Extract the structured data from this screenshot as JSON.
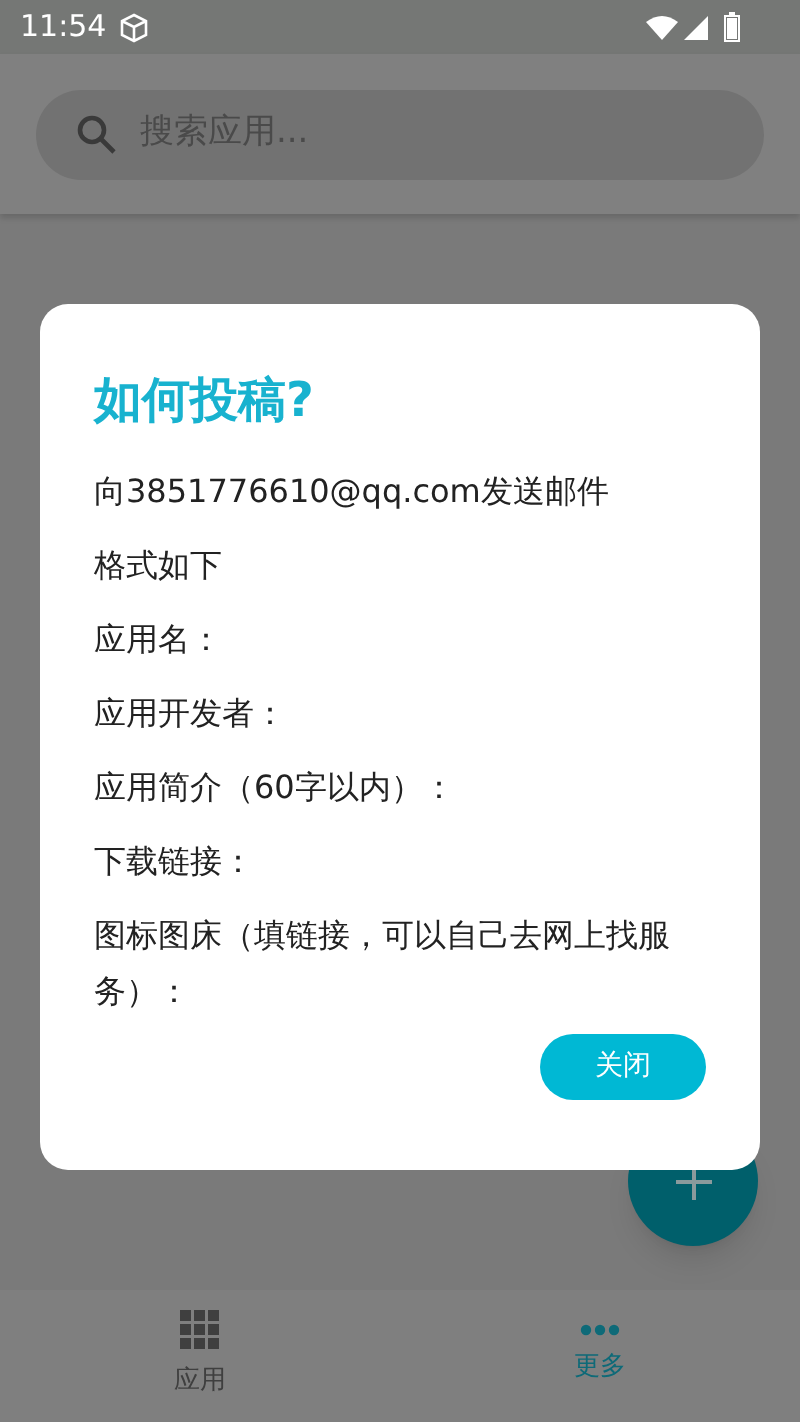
{
  "status_bar": {
    "time": "11:54"
  },
  "search": {
    "placeholder": "搜索应用..."
  },
  "dialog": {
    "title": "如何投稿?",
    "lines": [
      "向3851776610@qq.com发送邮件",
      "格式如下",
      "应用名：",
      "应用开发者：",
      "应用简介（60字以内）：",
      "下载链接：",
      "图标图床（填链接，可以自己去网上找服务）："
    ],
    "button": "关闭"
  },
  "bottom_nav": [
    {
      "label": "应用",
      "kind": "grid",
      "selected": false
    },
    {
      "label": "更多",
      "kind": "dots",
      "selected": true
    }
  ]
}
